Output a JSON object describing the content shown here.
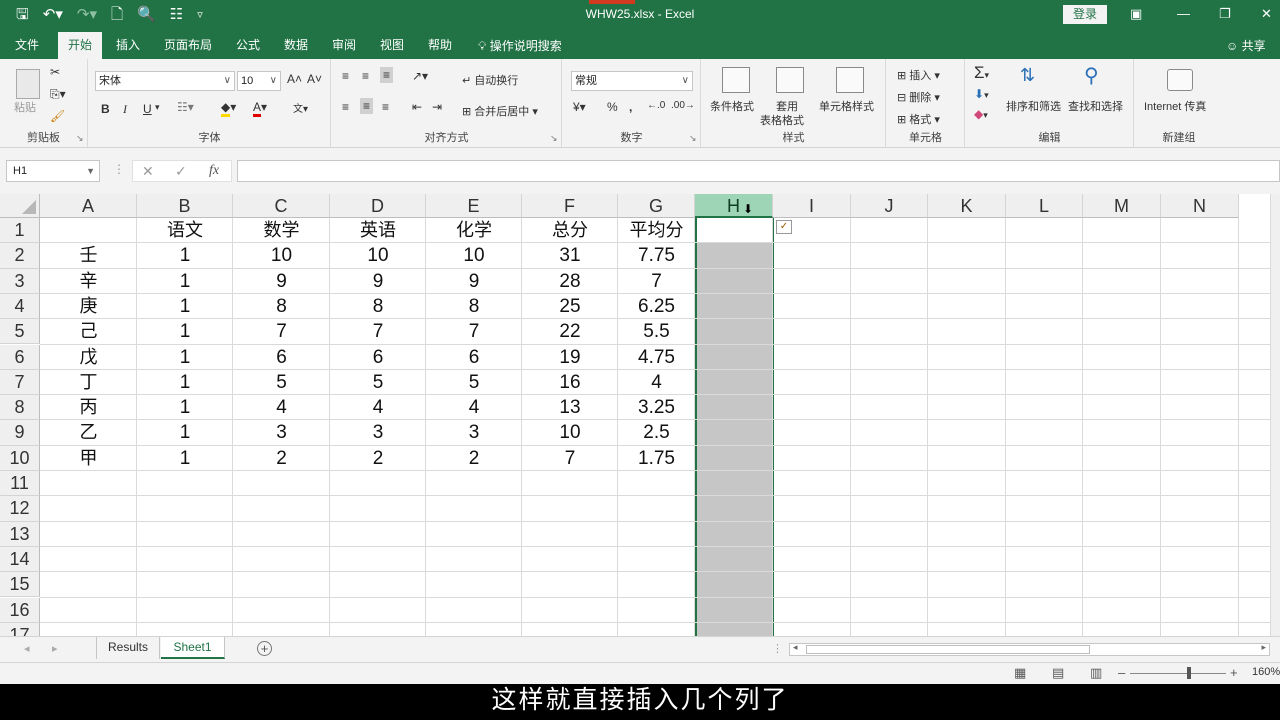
{
  "window": {
    "title": "WHW25.xlsx  -  Excel",
    "login_label": "登录",
    "accent_color": "#217346"
  },
  "qat": {
    "save_icon": "save-icon",
    "undo_icon": "undo-icon",
    "redo_icon": "redo-icon",
    "new_icon": "new-doc-icon",
    "preview_icon": "print-preview-icon",
    "form_icon": "form-icon",
    "customize_icon": "chevron-down-icon"
  },
  "menu": {
    "tabs": [
      "文件",
      "开始",
      "插入",
      "页面布局",
      "公式",
      "数据",
      "审阅",
      "视图",
      "帮助"
    ],
    "active_tab": "开始",
    "tell_me": "操作说明搜索",
    "share": "共享"
  },
  "ribbon": {
    "clipboard": {
      "paste": "粘贴",
      "label": "剪贴板"
    },
    "font": {
      "family": "宋体",
      "size": "10",
      "bold": "B",
      "italic": "I",
      "underline": "U",
      "label": "字体"
    },
    "alignment": {
      "wrap": "自动换行",
      "merge": "合并后居中",
      "label": "对齐方式"
    },
    "number": {
      "format": "常规",
      "percent": "%",
      "comma": ",",
      "label": "数字"
    },
    "styles": {
      "conditional": "条件格式",
      "table_line1": "套用",
      "table_line2": "表格格式",
      "cell_styles": "单元格样式",
      "label": "样式"
    },
    "cells": {
      "insert": "插入",
      "delete": "删除",
      "format": "格式",
      "label": "单元格"
    },
    "editing": {
      "sort": "排序和筛选",
      "find": "查找和选择",
      "label": "编辑"
    },
    "newgroup": {
      "fax": "Internet 传真",
      "label": "新建组"
    }
  },
  "formula_bar": {
    "name_box": "H1",
    "cancel_icon": "close-icon",
    "enter_icon": "check-icon",
    "fx_label": "fx",
    "formula": ""
  },
  "sheet": {
    "columns": [
      "A",
      "B",
      "C",
      "D",
      "E",
      "F",
      "G",
      "H",
      "I",
      "J",
      "K",
      "L",
      "M",
      "N"
    ],
    "selected_column": "H",
    "row_numbers": [
      "1",
      "2",
      "3",
      "4",
      "5",
      "6",
      "7",
      "8",
      "9",
      "10",
      "11",
      "12",
      "13",
      "14",
      "15",
      "16",
      "17"
    ],
    "header_row": [
      "",
      "语文",
      "数学",
      "英语",
      "化学",
      "总分",
      "平均分"
    ],
    "rows": [
      [
        "壬",
        "1",
        "10",
        "10",
        "10",
        "31",
        "7.75"
      ],
      [
        "辛",
        "1",
        "9",
        "9",
        "9",
        "28",
        "7"
      ],
      [
        "庚",
        "1",
        "8",
        "8",
        "8",
        "25",
        "6.25"
      ],
      [
        "己",
        "1",
        "7",
        "7",
        "7",
        "22",
        "5.5"
      ],
      [
        "戊",
        "1",
        "6",
        "6",
        "6",
        "19",
        "4.75"
      ],
      [
        "丁",
        "1",
        "5",
        "5",
        "5",
        "16",
        "4"
      ],
      [
        "丙",
        "1",
        "4",
        "4",
        "4",
        "13",
        "3.25"
      ],
      [
        "乙",
        "1",
        "3",
        "3",
        "3",
        "10",
        "2.5"
      ],
      [
        "甲",
        "1",
        "2",
        "2",
        "2",
        "7",
        "1.75"
      ]
    ]
  },
  "tabs_bar": {
    "sheets": [
      "Results",
      "Sheet1"
    ],
    "active_sheet": "Sheet1"
  },
  "status": {
    "zoom": "160%"
  },
  "subtitle": "这样就直接插入几个列了"
}
